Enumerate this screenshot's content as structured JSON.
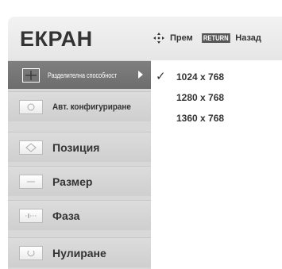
{
  "header": {
    "title": "ЕКРАН",
    "move_label": "Прем",
    "return_badge": "RETURN",
    "back_label": "Назад"
  },
  "sidebar": {
    "items": [
      {
        "label": "Разделителна способност",
        "icon": "crosshair-icon",
        "active": true
      },
      {
        "label": "Авт. конфигуриране",
        "icon": "auto-config-icon",
        "active": false
      },
      {
        "label": "Позиция",
        "icon": "position-icon",
        "active": false
      },
      {
        "label": "Размер",
        "icon": "size-icon",
        "active": false
      },
      {
        "label": "Фаза",
        "icon": "phase-icon",
        "active": false
      },
      {
        "label": "Нулиране",
        "icon": "reset-icon",
        "active": false
      }
    ]
  },
  "options": {
    "check_mark": "✓",
    "items": [
      "1024 x 768",
      "1280 x 768",
      "1360 x 768"
    ],
    "selected_index": 0
  },
  "colors": {
    "active_bg": "#757575",
    "sidebar_bg": "#d8d8d8",
    "text": "#333333"
  }
}
